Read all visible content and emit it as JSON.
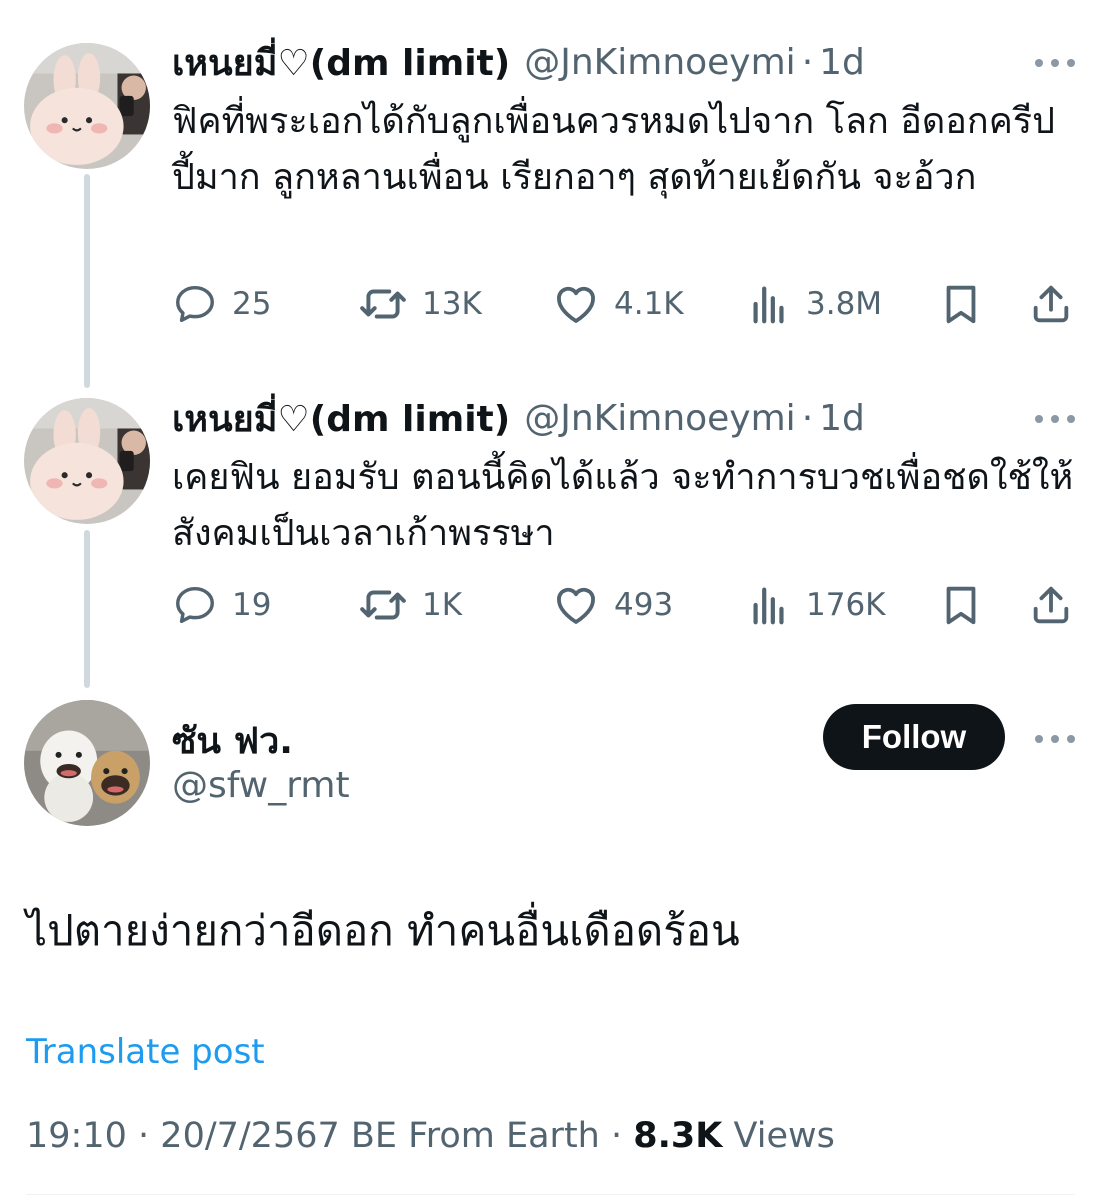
{
  "tweets": [
    {
      "author_name": "เหนยมี่♡(dm limit)",
      "handle": "@JnKimnoeymi",
      "separator": "·",
      "time_ago": "1d",
      "text": "ฟิคที่พระเอกได้กับลูกเพื่อนควรหมดไปจาก โลก อีดอกครีปปี้มาก ลูกหลานเพื่อน เรียกอาๆ สุดท้ายเย้ดกัน จะอ้วก",
      "stats": {
        "replies": "25",
        "reposts": "13K",
        "likes": "4.1K",
        "views": "3.8M"
      }
    },
    {
      "author_name": "เหนยมี่♡(dm limit)",
      "handle": "@JnKimnoeymi",
      "separator": "·",
      "time_ago": "1d",
      "text": "เคยฟิน ยอมรับ ตอนนี้คิดได้แล้ว จะทำการบวชเพื่อชดใช้ให้สังคมเป็นเวลาเก้าพรรษา",
      "stats": {
        "replies": "19",
        "reposts": "1K",
        "likes": "493",
        "views": "176K"
      }
    }
  ],
  "main": {
    "author_name": "ซัน ฟว.",
    "handle": "@sfw_rmt",
    "follow_label": "Follow",
    "text": "ไปตายง่ายกว่าอีดอก ทำคนอื่นเดือดร้อน",
    "translate_label": "Translate post",
    "time": "19:10",
    "date": "20/7/2567 BE",
    "source": "From Earth",
    "views_count": "8.3K",
    "views_label": "Views",
    "separator": "·"
  },
  "icons": {
    "reply": "reply-icon",
    "repost": "repost-icon",
    "like": "heart-icon",
    "views": "views-icon",
    "bookmark": "bookmark-icon",
    "share": "share-icon",
    "more": "more-icon"
  },
  "colors": {
    "text": "#0f1419",
    "secondary": "#536471",
    "link": "#1d9bf0",
    "thread_line": "#cfd9de",
    "follow_bg": "#0f1419"
  }
}
